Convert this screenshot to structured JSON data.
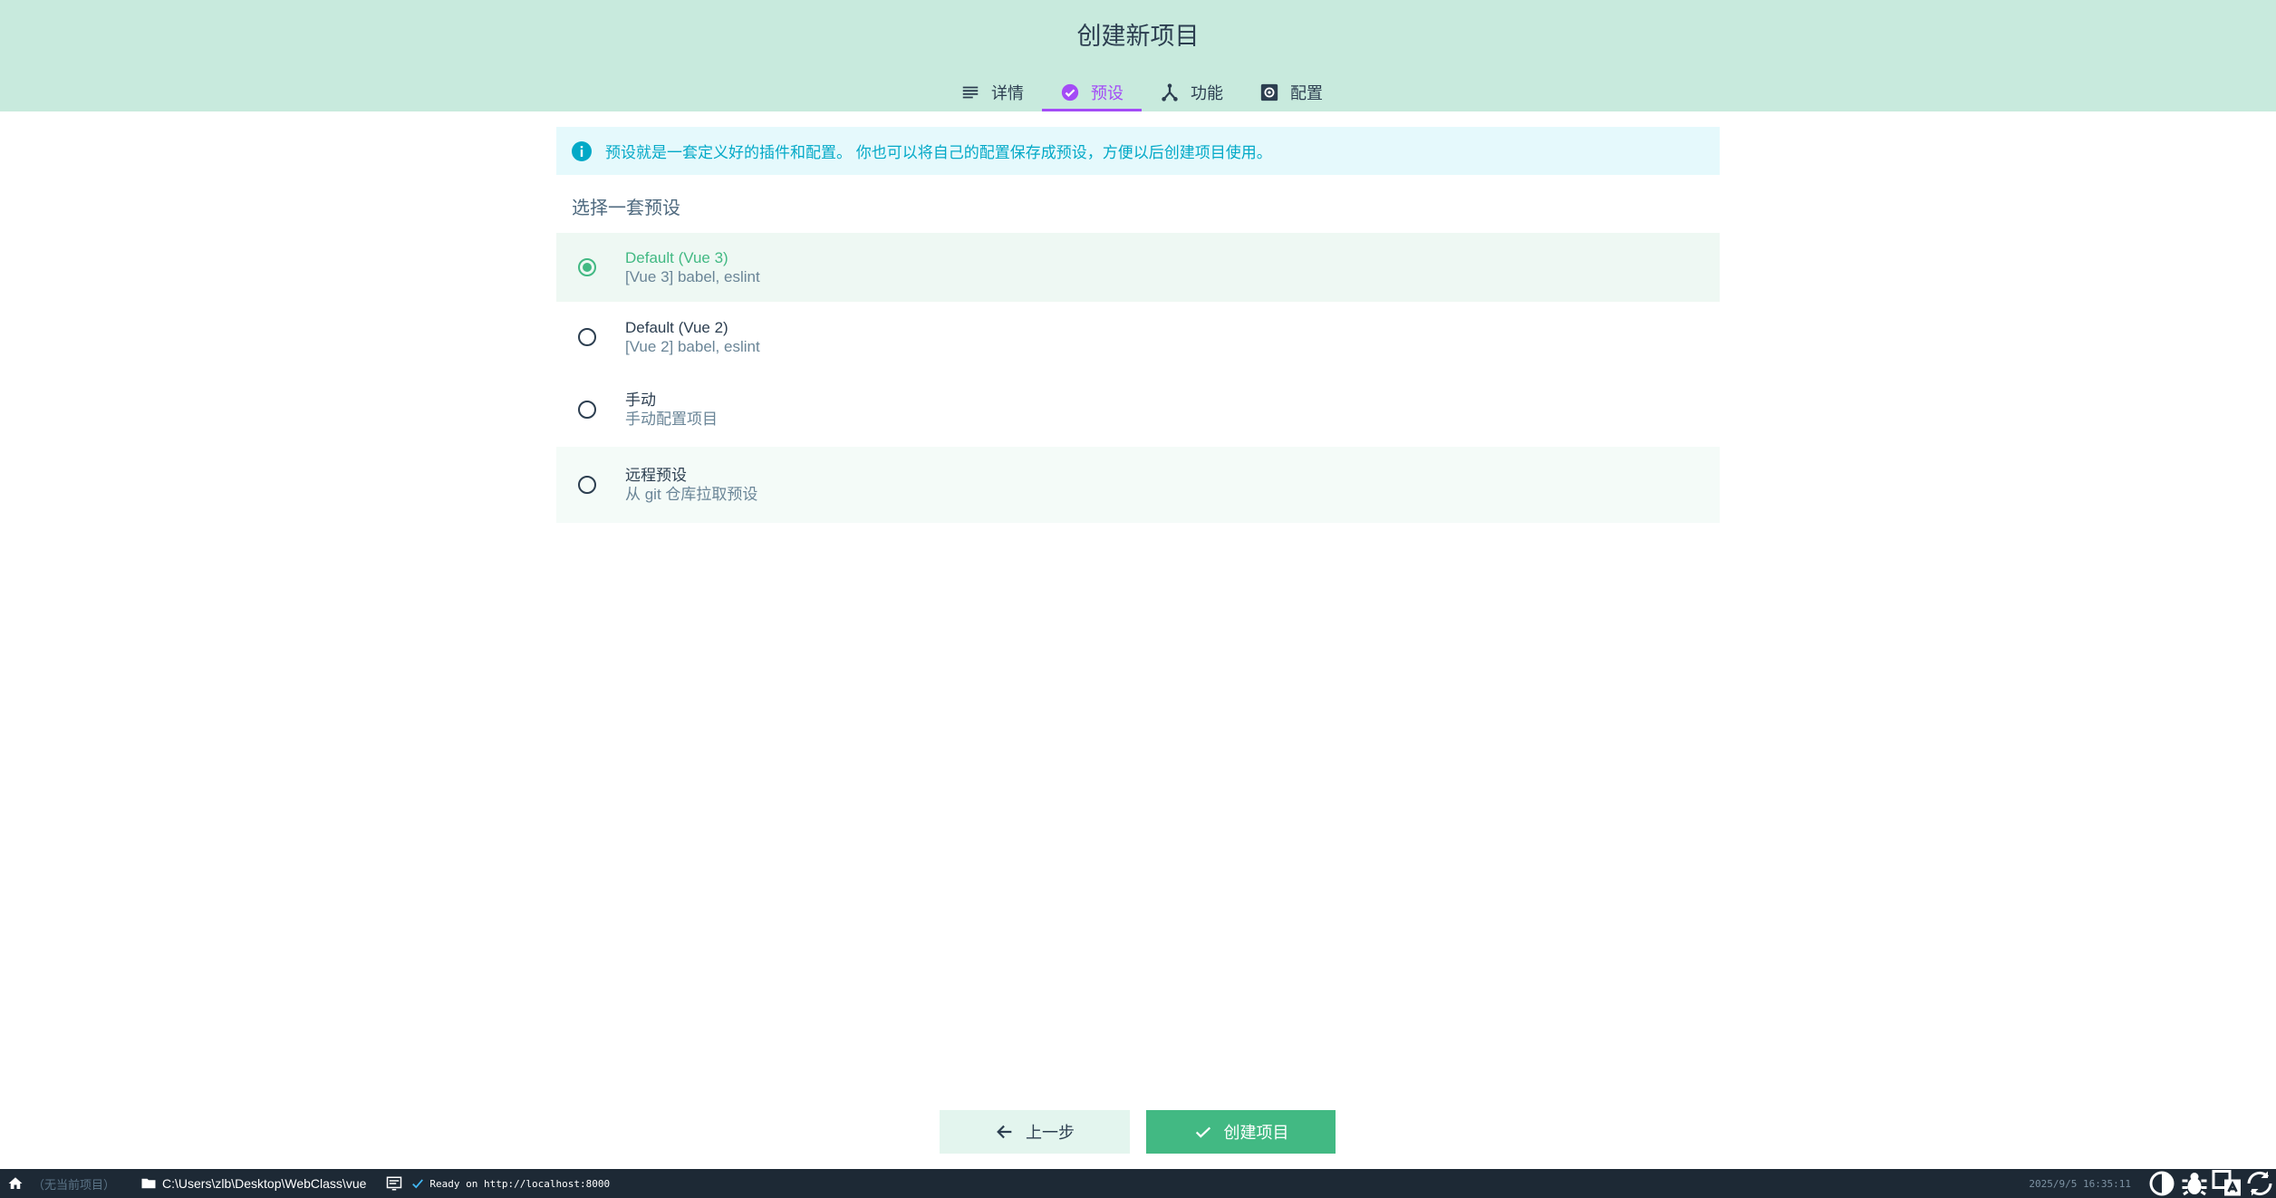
{
  "header": {
    "title": "创建新项目",
    "tabs": [
      {
        "label": "详情",
        "icon": "subject-icon",
        "active": false
      },
      {
        "label": "预设",
        "icon": "check-circle-icon",
        "active": true
      },
      {
        "label": "功能",
        "icon": "device-hub-icon",
        "active": false
      },
      {
        "label": "配置",
        "icon": "settings-applications-icon",
        "active": false
      }
    ]
  },
  "info": {
    "text": "预设就是一套定义好的插件和配置。 你也可以将自己的配置保存成预设，方便以后创建项目使用。",
    "color": "#03a9c7"
  },
  "presets": {
    "label": "选择一套预设",
    "items": [
      {
        "name": "Default (Vue 3)",
        "description": "[Vue 3] babel, eslint",
        "selected": true
      },
      {
        "name": "Default (Vue 2)",
        "description": "[Vue 2] babel, eslint",
        "selected": false
      },
      {
        "name": "手动",
        "description": "手动配置项目",
        "selected": false
      },
      {
        "name": "远程预设",
        "description": "从 git 仓库拉取预设",
        "selected": false
      }
    ]
  },
  "buttons": {
    "prev_label": "上一步",
    "create_label": "创建项目"
  },
  "statusbar": {
    "no_project": "（无当前项目）",
    "path": "C:\\Users\\zlb\\Desktop\\WebClass\\vue",
    "log": "Ready on http://localhost:8000",
    "time": "2025/9/5 16:35:11"
  },
  "colors": {
    "header_bg": "#c8eadd",
    "accent": "#42b983",
    "active_tab": "#a44cf6",
    "statusbar_bg": "#1d2935"
  }
}
